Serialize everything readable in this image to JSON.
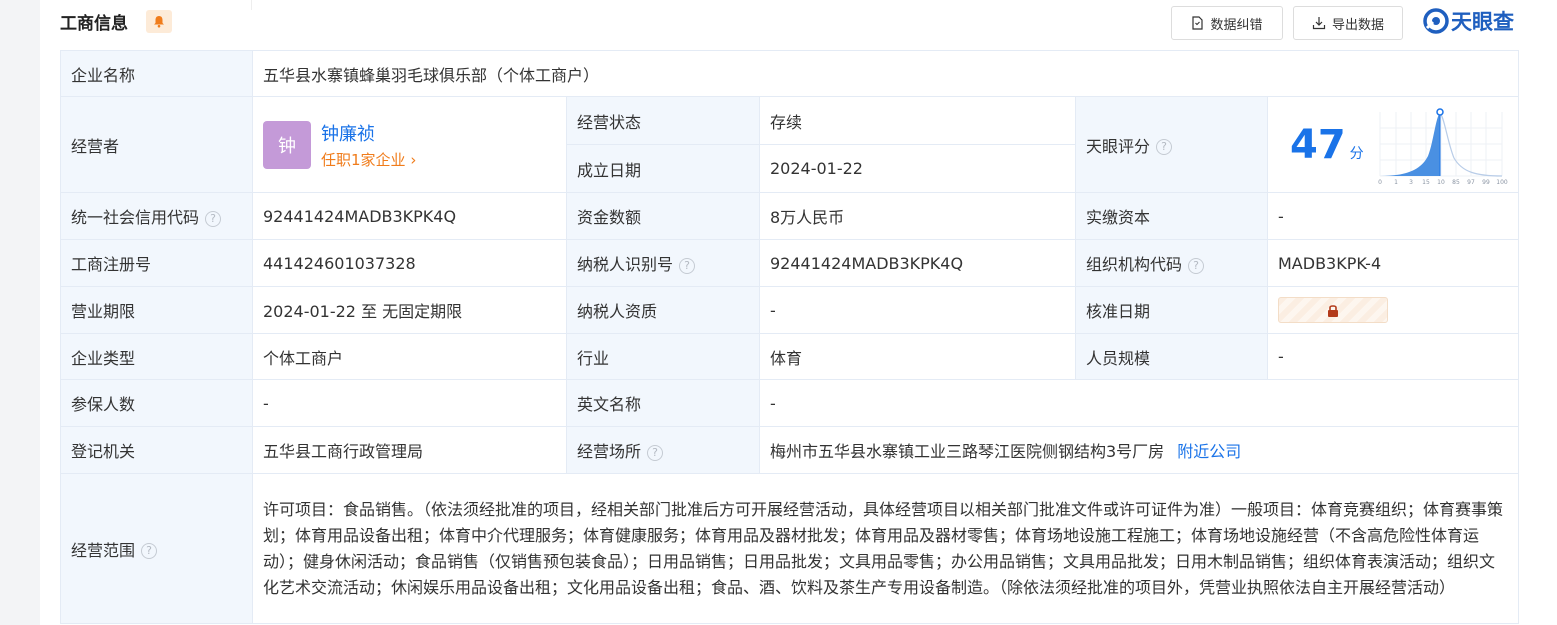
{
  "header": {
    "title": "工商信息",
    "btn_correct": "数据纠错",
    "btn_export": "导出数据",
    "brand": "天眼查"
  },
  "rows": {
    "company_name_label": "企业名称",
    "company_name": "五华县水寨镇蜂巢羽毛球俱乐部（个体工商户）",
    "operator_label": "经营者",
    "operator_avatar": "钟",
    "operator_name": "钟廉祯",
    "operator_positions": "任职1家企业",
    "status_label": "经营状态",
    "status_value": "存续",
    "found_label": "成立日期",
    "found_value": "2024-01-22",
    "score_label": "天眼评分",
    "score_value": "47",
    "score_unit": "分",
    "score_ticks": [
      "0",
      "1",
      "3",
      "15",
      "10",
      "85",
      "97",
      "99",
      "100"
    ],
    "credit_label": "统一社会信用代码",
    "credit_value": "92441424MADB3KPK4Q",
    "capital_label": "资金数额",
    "capital_value": "8万人民币",
    "paid_label": "实缴资本",
    "paid_value": "-",
    "reg_label": "工商注册号",
    "reg_value": "441424601037328",
    "tax_label": "纳税人识别号",
    "tax_value": "92441424MADB3KPK4Q",
    "org_label": "组织机构代码",
    "org_value": "MADB3KPK-4",
    "term_label": "营业期限",
    "term_value": "2024-01-22 至 无固定期限",
    "taxq_label": "纳税人资质",
    "taxq_value": "-",
    "approve_label": "核准日期",
    "type_label": "企业类型",
    "type_value": "个体工商户",
    "industry_label": "行业",
    "industry_value": "体育",
    "staff_label": "人员规模",
    "staff_value": "-",
    "insured_label": "参保人数",
    "insured_value": "-",
    "en_label": "英文名称",
    "en_value": "-",
    "authority_label": "登记机关",
    "authority_value": "五华县工商行政管理局",
    "address_label": "经营场所",
    "address_value": "梅州市五华县水寨镇工业三路琴江医院侧钢结构3号厂房",
    "nearby_link": "附近公司",
    "scope_label": "经营范围",
    "scope_value": "许可项目：食品销售。（依法须经批准的项目，经相关部门批准后方可开展经营活动，具体经营项目以相关部门批准文件或许可证件为准）一般项目：体育竞赛组织；体育赛事策划；体育用品设备出租；体育中介代理服务；体育健康服务；体育用品及器材批发；体育用品及器材零售；体育场地设施工程施工；体育场地设施经营（不含高危险性体育运动）；健身休闲活动；食品销售（仅销售预包装食品）；日用品销售；日用品批发；文具用品零售；办公用品销售；文具用品批发；日用木制品销售；组织体育表演活动；组织文化艺术交流活动；休闲娱乐用品设备出租；文化用品设备出租；食品、酒、饮料及茶生产专用设备制造。（除依法须经批准的项目外，凭营业执照依法自主开展经营活动）"
  },
  "colors": {
    "label_bg": "#f2f7fd",
    "link": "#1a73e8",
    "status_green": "#34a853",
    "avatar_bg": "#c49ad8",
    "position_orange": "#f07c1b"
  }
}
